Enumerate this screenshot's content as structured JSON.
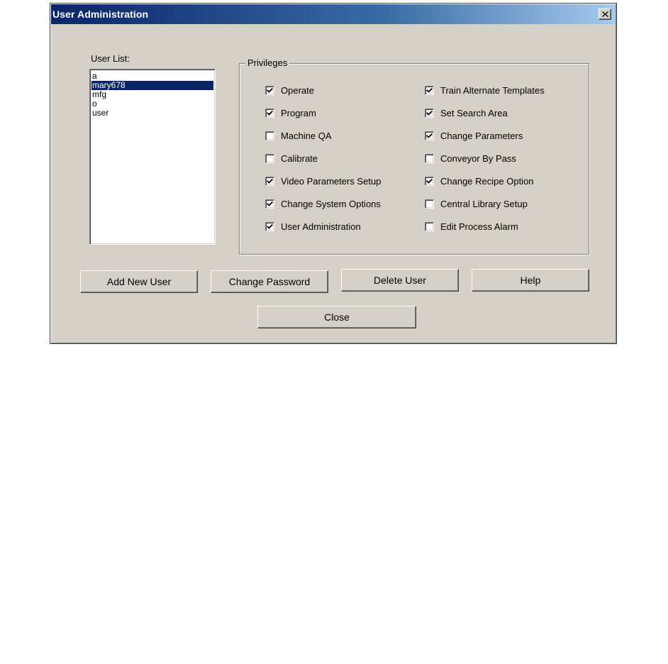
{
  "window": {
    "title": "User Administration"
  },
  "user_list": {
    "label": "User List:",
    "items": [
      {
        "name": "a",
        "selected": false
      },
      {
        "name": "mary678",
        "selected": true
      },
      {
        "name": "mfg",
        "selected": false
      },
      {
        "name": "o",
        "selected": false
      },
      {
        "name": "user",
        "selected": false
      }
    ]
  },
  "privileges": {
    "label": "Privileges",
    "left": [
      {
        "label": "Operate",
        "checked": true
      },
      {
        "label": "Program",
        "checked": true
      },
      {
        "label": "Machine QA",
        "checked": false
      },
      {
        "label": "Calibrate",
        "checked": false
      },
      {
        "label": "Video Parameters Setup",
        "checked": true
      },
      {
        "label": "Change System Options",
        "checked": true
      },
      {
        "label": "User Administration",
        "checked": true
      }
    ],
    "right": [
      {
        "label": "Train Alternate Templates",
        "checked": true
      },
      {
        "label": "Set Search Area",
        "checked": true
      },
      {
        "label": "Change Parameters",
        "checked": true
      },
      {
        "label": "Conveyor By Pass",
        "checked": false
      },
      {
        "label": "Change Recipe Option",
        "checked": true
      },
      {
        "label": "Central Library Setup",
        "checked": false
      },
      {
        "label": "Edit Process Alarm",
        "checked": false
      }
    ]
  },
  "buttons": {
    "add_new_user": "Add New User",
    "change_password": "Change Password",
    "delete_user": "Delete User",
    "help": "Help",
    "close": "Close"
  },
  "colors": {
    "selection": "#0a246a",
    "face": "#d4d0c8",
    "title_gradient_start": "#0a246a",
    "title_gradient_end": "#a6caf0"
  },
  "icons": {
    "close": "close-icon",
    "check": "check-icon"
  }
}
